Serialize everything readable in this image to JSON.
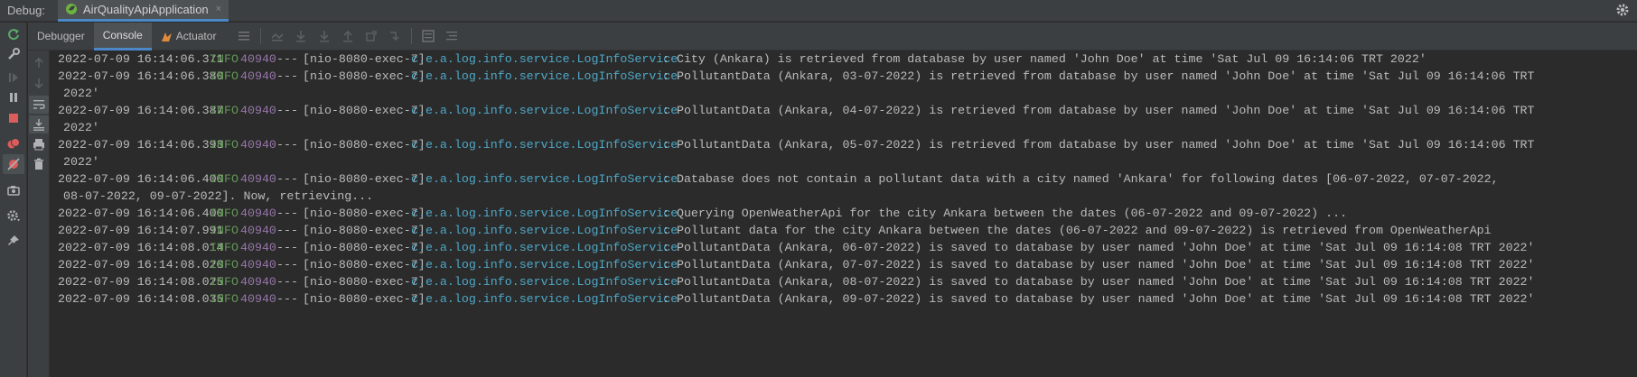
{
  "titlebar": {
    "debug_label": "Debug:",
    "run_tab_label": "AirQualityApiApplication",
    "close_glyph": "×"
  },
  "tabs": [
    {
      "label": "Debugger",
      "active": false
    },
    {
      "label": "Console",
      "active": true
    },
    {
      "label": "Actuator",
      "active": false,
      "icon": "actuator-icon"
    }
  ],
  "colors": {
    "info": "#629755",
    "pid": "#9876aa",
    "logger": "#4ea8c7",
    "accent": "#4a88c7",
    "text": "#bbbbbb"
  },
  "console": {
    "lines": [
      {
        "ts": "2022-07-09 16:14:06.371",
        "level": "INFO",
        "pid": "40940",
        "sep": "---",
        "thread": "[nio-8080-exec-7]",
        "logger": "c.e.a.log.info.service.LogInfoService",
        "msg": ": City (Ankara) is retrieved from database by user named 'John Doe' at time 'Sat Jul 09 16:14:06 TRT 2022'"
      },
      {
        "ts": "2022-07-09 16:14:06.380",
        "level": "INFO",
        "pid": "40940",
        "sep": "---",
        "thread": "[nio-8080-exec-7]",
        "logger": "c.e.a.log.info.service.LogInfoService",
        "msg": ": PollutantData (Ankara, 03-07-2022) is retrieved from database by user named 'John Doe' at time 'Sat Jul 09 16:14:06 TRT",
        "cont": "2022'"
      },
      {
        "ts": "2022-07-09 16:14:06.387",
        "level": "INFO",
        "pid": "40940",
        "sep": "---",
        "thread": "[nio-8080-exec-7]",
        "logger": "c.e.a.log.info.service.LogInfoService",
        "msg": ": PollutantData (Ankara, 04-07-2022) is retrieved from database by user named 'John Doe' at time 'Sat Jul 09 16:14:06 TRT",
        "cont": "2022'"
      },
      {
        "ts": "2022-07-09 16:14:06.393",
        "level": "INFO",
        "pid": "40940",
        "sep": "---",
        "thread": "[nio-8080-exec-7]",
        "logger": "c.e.a.log.info.service.LogInfoService",
        "msg": ": PollutantData (Ankara, 05-07-2022) is retrieved from database by user named 'John Doe' at time 'Sat Jul 09 16:14:06 TRT",
        "cont": "2022'"
      },
      {
        "ts": "2022-07-09 16:14:06.400",
        "level": "INFO",
        "pid": "40940",
        "sep": "---",
        "thread": "[nio-8080-exec-7]",
        "logger": "c.e.a.log.info.service.LogInfoService",
        "msg": ": Database does not contain a pollutant data with a city named 'Ankara' for following dates [06-07-2022, 07-07-2022,",
        "cont": "08-07-2022, 09-07-2022]. Now, retrieving..."
      },
      {
        "ts": "2022-07-09 16:14:06.400",
        "level": "INFO",
        "pid": "40940",
        "sep": "---",
        "thread": "[nio-8080-exec-7]",
        "logger": "c.e.a.log.info.service.LogInfoService",
        "msg": ": Querying OpenWeatherApi for the city Ankara between the dates (06-07-2022 and 09-07-2022) ..."
      },
      {
        "ts": "2022-07-09 16:14:07.991",
        "level": "INFO",
        "pid": "40940",
        "sep": "---",
        "thread": "[nio-8080-exec-7]",
        "logger": "c.e.a.log.info.service.LogInfoService",
        "msg": ": Pollutant data for the city Ankara between the dates (06-07-2022 and 09-07-2022) is retrieved from OpenWeatherApi"
      },
      {
        "ts": "2022-07-09 16:14:08.014",
        "level": "INFO",
        "pid": "40940",
        "sep": "---",
        "thread": "[nio-8080-exec-7]",
        "logger": "c.e.a.log.info.service.LogInfoService",
        "msg": ": PollutantData (Ankara, 06-07-2022) is saved to database by user named 'John Doe' at time 'Sat Jul 09 16:14:08 TRT 2022'"
      },
      {
        "ts": "2022-07-09 16:14:08.020",
        "level": "INFO",
        "pid": "40940",
        "sep": "---",
        "thread": "[nio-8080-exec-7]",
        "logger": "c.e.a.log.info.service.LogInfoService",
        "msg": ": PollutantData (Ankara, 07-07-2022) is saved to database by user named 'John Doe' at time 'Sat Jul 09 16:14:08 TRT 2022'"
      },
      {
        "ts": "2022-07-09 16:14:08.025",
        "level": "INFO",
        "pid": "40940",
        "sep": "---",
        "thread": "[nio-8080-exec-7]",
        "logger": "c.e.a.log.info.service.LogInfoService",
        "msg": ": PollutantData (Ankara, 08-07-2022) is saved to database by user named 'John Doe' at time 'Sat Jul 09 16:14:08 TRT 2022'"
      },
      {
        "ts": "2022-07-09 16:14:08.035",
        "level": "INFO",
        "pid": "40940",
        "sep": "---",
        "thread": "[nio-8080-exec-7]",
        "logger": "c.e.a.log.info.service.LogInfoService",
        "msg": ": PollutantData (Ankara, 09-07-2022) is saved to database by user named 'John Doe' at time 'Sat Jul 09 16:14:08 TRT 2022'"
      }
    ]
  }
}
